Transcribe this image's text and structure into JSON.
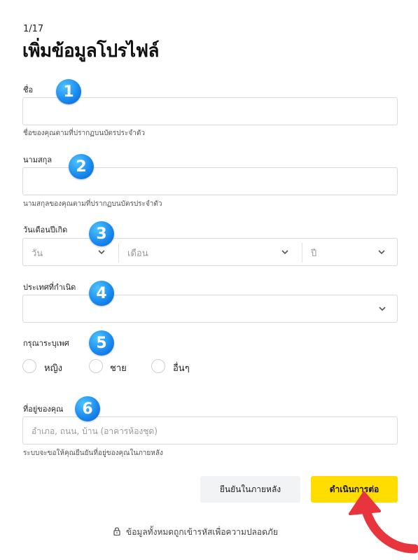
{
  "form": {
    "step": "1/17",
    "title": "เพิ่มข้อมูลโปรไฟล์",
    "first_name": {
      "label": "ชื่อ",
      "value": "",
      "hint": "ชื่อของคุณตามที่ปรากฏบนบัตรประจำตัว"
    },
    "last_name": {
      "label": "นามสกุล",
      "value": "",
      "hint": "นามสกุลของคุณตามที่ปรากฏบนบัตรประจำตัว"
    },
    "birthdate": {
      "label": "วันเดือนปีเกิด",
      "day_placeholder": "วัน",
      "month_placeholder": "เดือน",
      "year_placeholder": "ปี"
    },
    "birth_country": {
      "label": "ประเทศที่กำเนิด",
      "value": ""
    },
    "gender": {
      "label": "กรุณาระบุเพศ",
      "options": [
        "หญิง",
        "ชาย",
        "อื่นๆ"
      ]
    },
    "address": {
      "label": "ที่อยู่ของคุณ",
      "placeholder": "อำเภอ, ถนน, บ้าน (อาคารห้องชุด)",
      "hint": "ระบบจะขอให้คุณยืนยันที่อยู่ของคุณในภายหลัง"
    }
  },
  "buttons": {
    "confirm_later": "ยืนยันในภายหลัง",
    "continue": "ดำเนินการต่อ"
  },
  "footer": {
    "security_note": "ข้อมูลทั้งหมดถูกเข้ารหัสเพื่อความปลอดภัย"
  },
  "annotations": {
    "badges": [
      "1",
      "2",
      "3",
      "4",
      "5",
      "6"
    ],
    "badge_color": "#1a8cf0",
    "arrow_color": "#e8343c"
  },
  "colors": {
    "primary_button": "#ffdd00",
    "secondary_button": "#f2f3f5",
    "field_border": "#d9d9d9"
  }
}
